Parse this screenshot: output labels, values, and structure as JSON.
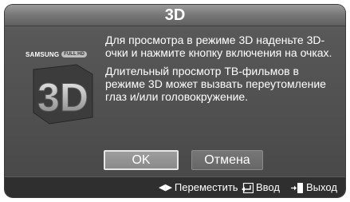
{
  "dialog": {
    "title": "3D",
    "brand": "SAMSUNG",
    "brand_badge": "FULL HD",
    "logo_text": "3D",
    "message": [
      "Для просмотра в режиме 3D наденьте 3D-очки и нажмите кнопку включения на очках.",
      "Длительный просмотр ТВ-фильмов в режиме 3D может вызвать переутомление глаз и/или головокружение."
    ],
    "ok_label": "OK",
    "cancel_label": "Отмена"
  },
  "footer": {
    "move_label": "Переместить",
    "enter_label": "Ввод",
    "exit_label": "Выход"
  },
  "icons": {
    "move": "left-right-arrows-icon",
    "enter": "enter-icon",
    "exit": "exit-icon"
  }
}
